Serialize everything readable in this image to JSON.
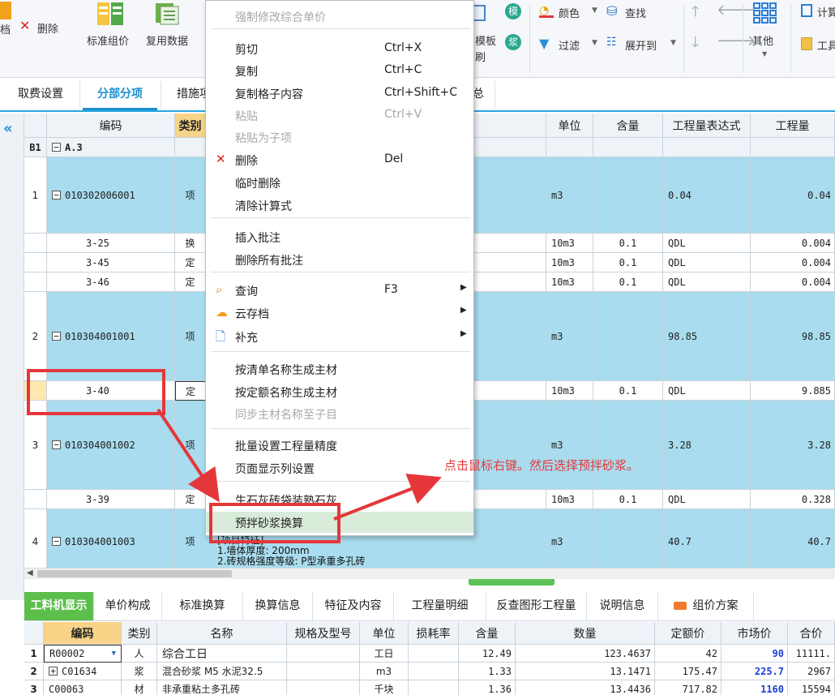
{
  "ribbon": {
    "doc_label": "档",
    "delete_label": "删除",
    "std_price_label": "标准组价",
    "reuse_label": "复用数据",
    "tpl_label_1": "模板",
    "tpl_label_2": "刷",
    "mo_label": "模",
    "jiang_label": "浆",
    "color_label": "颜色",
    "find_label": "查找",
    "filter_label": "过滤",
    "expand_label": "展开到",
    "other_label": "其他",
    "calc_label": "计算",
    "tool_label": "工具"
  },
  "tabs": [
    "取费设置",
    "分部分项",
    "措施项目",
    "总"
  ],
  "grid": {
    "headers": {
      "code": "编码",
      "type": "类别",
      "unit": "单位",
      "qty": "含量",
      "expr": "工程量表达式",
      "amount": "工程量"
    },
    "rows": [
      {
        "idx": "B1",
        "code": "A.3",
        "type": "",
        "unit": "",
        "qty": "",
        "expr": "",
        "amount": "",
        "kind": "section"
      },
      {
        "idx": "1",
        "code": "010302006001",
        "type": "项",
        "unit": "m3",
        "qty": "",
        "expr": "0.04",
        "amount": "0.04",
        "kind": "item"
      },
      {
        "idx": "",
        "code": "3-25",
        "type": "换",
        "unit": "10m3",
        "qty": "0.1",
        "expr": "QDL",
        "amount": "0.004",
        "kind": "sub"
      },
      {
        "idx": "",
        "code": "3-45",
        "type": "定",
        "unit": "10m3",
        "qty": "0.1",
        "expr": "QDL",
        "amount": "0.004",
        "kind": "sub"
      },
      {
        "idx": "",
        "code": "3-46",
        "type": "定",
        "unit": "10m3",
        "qty": "0.1",
        "expr": "QDL",
        "amount": "0.004",
        "kind": "sub"
      },
      {
        "idx": "2",
        "code": "010304001001",
        "type": "项",
        "unit": "m3",
        "qty": "",
        "expr": "98.85",
        "amount": "98.85",
        "kind": "item"
      },
      {
        "idx": "",
        "code": "3-40",
        "type": "定",
        "unit": "10m3",
        "qty": "0.1",
        "expr": "QDL",
        "amount": "9.885",
        "kind": "sub"
      },
      {
        "idx": "3",
        "code": "010304001002",
        "type": "项",
        "unit": "m3",
        "qty": "",
        "expr": "3.28",
        "amount": "3.28",
        "kind": "item"
      },
      {
        "idx": "",
        "code": "3-39",
        "type": "定",
        "unit": "10m3",
        "qty": "0.1",
        "expr": "QDL",
        "amount": "0.328",
        "kind": "sub"
      },
      {
        "idx": "4",
        "code": "010304001003",
        "type": "项",
        "unit": "m3",
        "qty": "",
        "expr": "40.7",
        "amount": "40.7",
        "kind": "item"
      }
    ],
    "row4_desc_1": "1.墙体厚度: 200mm",
    "row4_desc_2": "2.砖规格强度等级: P型承重多孔砖",
    "row4_desc_0": "[项目特征]"
  },
  "context_menu": {
    "items": [
      {
        "label": "强制修改综合单价",
        "shortcut": "",
        "disabled": true
      },
      {
        "label": "剪切",
        "shortcut": "Ctrl+X"
      },
      {
        "label": "复制",
        "shortcut": "Ctrl+C"
      },
      {
        "label": "复制格子内容",
        "shortcut": "Ctrl+Shift+C"
      },
      {
        "label": "粘贴",
        "shortcut": "Ctrl+V",
        "disabled": true
      },
      {
        "label": "粘贴为子项",
        "shortcut": "",
        "disabled": true
      },
      {
        "label": "删除",
        "shortcut": "Del"
      },
      {
        "label": "临时删除",
        "shortcut": ""
      },
      {
        "label": "清除计算式",
        "shortcut": ""
      },
      {
        "label": "插入批注",
        "shortcut": ""
      },
      {
        "label": "删除所有批注",
        "shortcut": ""
      },
      {
        "label": "查询",
        "shortcut": "F3"
      },
      {
        "label": "云存档",
        "shortcut": ""
      },
      {
        "label": "补充",
        "shortcut": ""
      },
      {
        "label": "按清单名称生成主材",
        "shortcut": ""
      },
      {
        "label": "按定额名称生成主材",
        "shortcut": ""
      },
      {
        "label": "同步主材名称至子目",
        "shortcut": "",
        "disabled": true
      },
      {
        "label": "批量设置工程量精度",
        "shortcut": ""
      },
      {
        "label": "页面显示列设置",
        "shortcut": ""
      },
      {
        "label": "生石灰砖袋装熟石灰",
        "shortcut": ""
      },
      {
        "label": "预拌砂浆换算",
        "shortcut": ""
      }
    ]
  },
  "annotation": {
    "note": "点击鼠标右键。然后选择预拌砂浆。"
  },
  "bottom_tabs": [
    "工料机显示",
    "单价构成",
    "标准换算",
    "换算信息",
    "特征及内容",
    "工程量明细",
    "反查图形工程量",
    "说明信息",
    "组价方案"
  ],
  "bottom_grid": {
    "headers": {
      "code": "编码",
      "type": "类别",
      "name": "名称",
      "spec": "规格及型号",
      "unit": "单位",
      "loss": "损耗率",
      "qty": "含量",
      "amount": "数量",
      "quota_price": "定额价",
      "market_price": "市场价",
      "total": "合价"
    },
    "rows": [
      {
        "idx": "1",
        "code": "R00002",
        "type": "人",
        "name": "综合工日",
        "spec": "",
        "unit": "工日",
        "loss": "",
        "qty": "12.49",
        "amount": "123.4637",
        "quota_price": "42",
        "market_price": "90",
        "total": "11111."
      },
      {
        "idx": "2",
        "code": "C01634",
        "type": "浆",
        "name": "混合砂浆 M5 水泥32.5",
        "spec": "",
        "unit": "m3",
        "loss": "",
        "qty": "1.33",
        "amount": "13.1471",
        "quota_price": "175.47",
        "market_price": "225.7",
        "total": "2967"
      },
      {
        "idx": "3",
        "code": "C00063",
        "type": "材",
        "name": "非承重粘土多孔砖",
        "spec": "",
        "unit": "千块",
        "loss": "",
        "qty": "1.36",
        "amount": "13.4436",
        "quota_price": "717.82",
        "market_price": "1160",
        "total": "15594"
      }
    ]
  }
}
